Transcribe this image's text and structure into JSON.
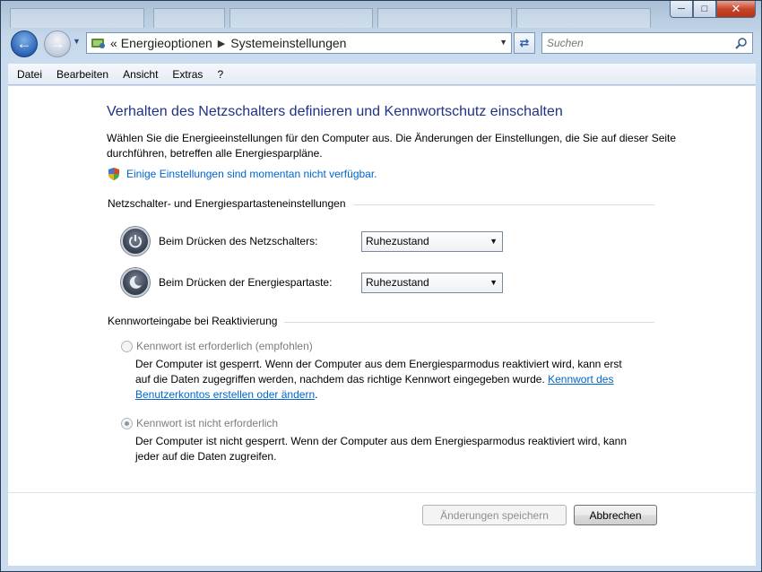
{
  "window": {
    "caption_buttons": {
      "minimize": "─",
      "maximize": "□",
      "close": "✕"
    }
  },
  "nav": {
    "back_icon": "arrow-left-icon",
    "forward_icon": "arrow-right-icon",
    "address": {
      "separator_lead": "«",
      "crumbs": [
        "Energieoptionen",
        "Systemeinstellungen"
      ]
    },
    "search_placeholder": "Suchen"
  },
  "menu": [
    "Datei",
    "Bearbeiten",
    "Ansicht",
    "Extras",
    "?"
  ],
  "page": {
    "title": "Verhalten des Netzschalters definieren und Kennwortschutz einschalten",
    "description": "Wählen Sie die Energieeinstellungen für den Computer aus. Die Änderungen der Einstellungen, die Sie auf dieser Seite durchführen, betreffen alle Energiesparpläne.",
    "unavailable_link": "Einige Einstellungen sind momentan nicht verfügbar.",
    "section_buttons": "Netzschalter- und Energiespartasteneinstellungen",
    "power_button_label": "Beim Drücken des Netzschalters:",
    "power_button_value": "Ruhezustand",
    "sleep_button_label": "Beim Drücken der Energiespartaste:",
    "sleep_button_value": "Ruhezustand",
    "section_password": "Kennworteingabe bei Reaktivierung",
    "option_required": {
      "label": "Kennwort ist erforderlich (empfohlen)",
      "desc": "Der Computer ist gesperrt. Wenn der Computer aus dem Energiesparmodus reaktiviert wird, kann erst auf die Daten zugegriffen werden, nachdem das richtige Kennwort eingegeben wurde.",
      "link": "Kennwort des Benutzerkontos erstellen oder ändern",
      "link_suffix": "."
    },
    "option_not_required": {
      "label": "Kennwort ist nicht erforderlich",
      "desc": "Der Computer ist nicht gesperrt. Wenn der Computer aus dem Energiesparmodus reaktiviert wird, kann jeder auf die Daten zugreifen."
    }
  },
  "buttons": {
    "save": "Änderungen speichern",
    "cancel": "Abbrechen"
  },
  "colors": {
    "title": "#1e3287",
    "link": "#0066cc",
    "window_frame": "#c5d7ea"
  }
}
